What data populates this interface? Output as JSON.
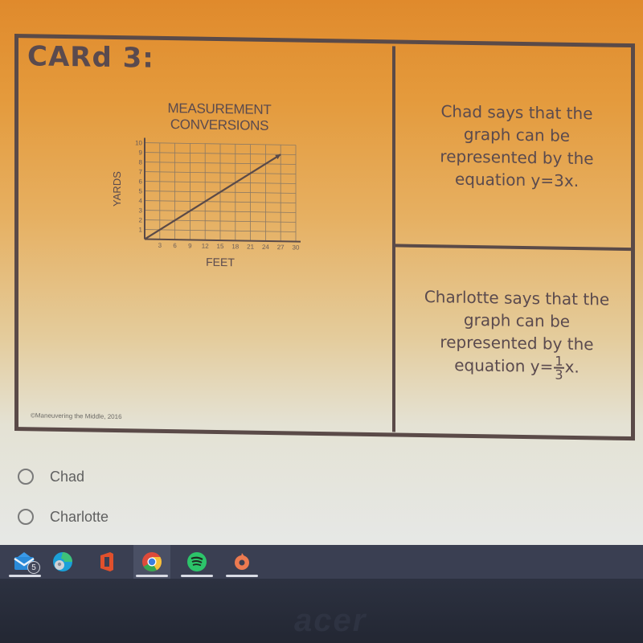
{
  "card": {
    "title": "CARd 3:",
    "copyright": "©Maneuvering the Middle, 2016",
    "claims": [
      {
        "person": "Chad",
        "lines": [
          "Chad says that the",
          "graph can be",
          "represented by the"
        ],
        "equation_prefix": "equation y=3x."
      },
      {
        "person": "Charlotte",
        "lines": [
          "Charlotte says that the",
          "graph can be",
          "represented by the"
        ],
        "equation_prefix": "equation y=",
        "fraction_num": "1",
        "fraction_den": "3",
        "equation_suffix": "x."
      }
    ]
  },
  "chart_data": {
    "type": "line",
    "title": "MEASUREMENT CONVERSIONS",
    "title_lines": [
      "MEASUREMENT",
      "CONVERSIONS"
    ],
    "xlabel": "FEET",
    "ylabel": "YARDS",
    "x_ticks": [
      3,
      6,
      9,
      12,
      15,
      18,
      21,
      24,
      27,
      30
    ],
    "y_ticks": [
      1,
      2,
      3,
      4,
      5,
      6,
      7,
      8,
      9,
      10
    ],
    "xlim": [
      0,
      30
    ],
    "ylim": [
      0,
      10
    ],
    "grid": true,
    "series": [
      {
        "name": "yards vs feet",
        "x": [
          0,
          27
        ],
        "y": [
          0,
          9
        ],
        "arrow_end": true
      }
    ],
    "colors": {
      "line": "#5a4a48",
      "grid": "#8c7a64",
      "text": "#6a5c58"
    }
  },
  "options": [
    {
      "label": "Chad",
      "selected": false
    },
    {
      "label": "Charlotte",
      "selected": false
    }
  ],
  "taskbar": {
    "items": [
      {
        "name": "mail",
        "badge": "5",
        "active": false,
        "open": true
      },
      {
        "name": "edge",
        "active": false,
        "open": false
      },
      {
        "name": "office",
        "active": false,
        "open": false
      },
      {
        "name": "chrome",
        "active": true,
        "open": true
      },
      {
        "name": "spotify",
        "active": false,
        "open": true
      },
      {
        "name": "origin",
        "active": false,
        "open": true
      }
    ]
  },
  "bezel": {
    "brand": "acer"
  }
}
